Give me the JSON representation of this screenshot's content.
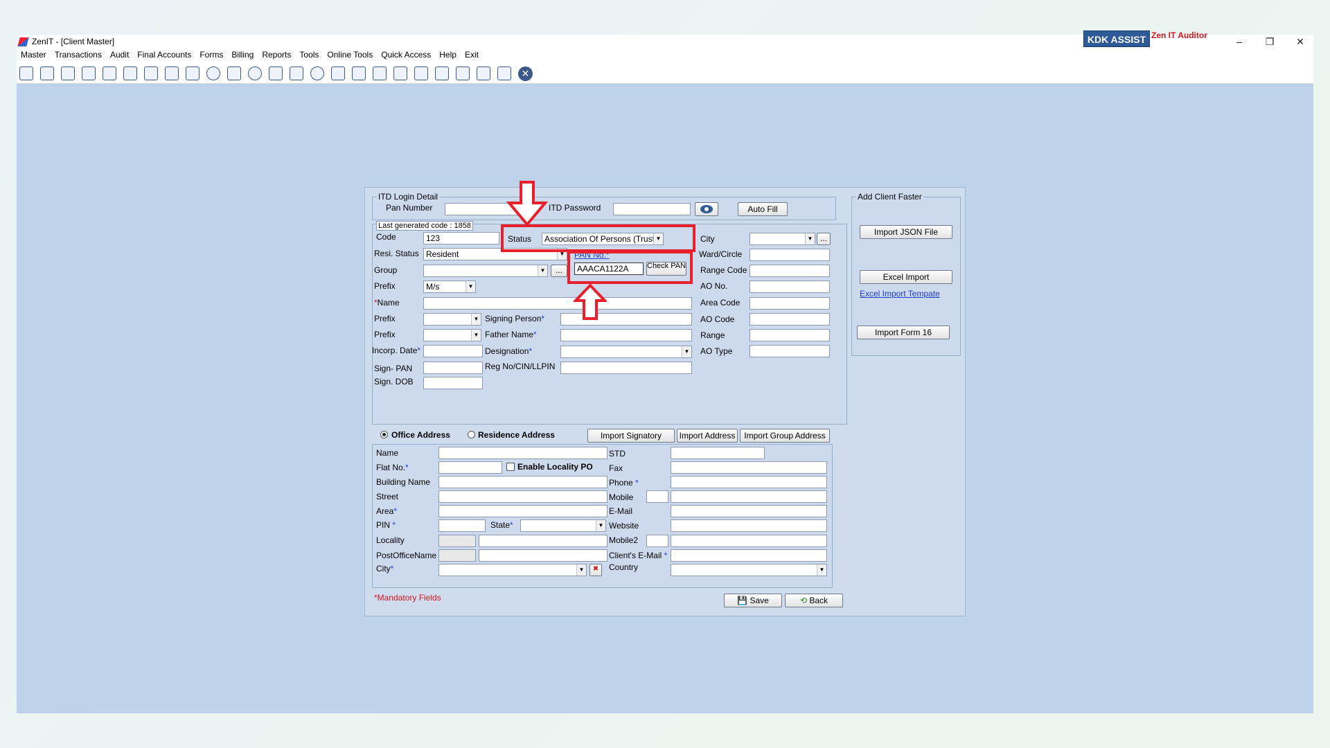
{
  "window": {
    "title": "ZenIT - [Client Master]"
  },
  "menu": [
    "Master",
    "Transactions",
    "Audit",
    "Final Accounts",
    "Forms",
    "Billing",
    "Reports",
    "Tools",
    "Online Tools",
    "Quick Access",
    "Help",
    "Exit"
  ],
  "brand": {
    "kdk": "KDK ASSIST",
    "auditor": "Zen IT Auditor"
  },
  "itd": {
    "legend": "ITD Login Detail",
    "pan_label": "Pan Number",
    "password_label": "ITD Password",
    "autofill": "Auto Fill"
  },
  "client": {
    "last_code": "Last generated code : 1858",
    "code_label": "Code",
    "code_value": "123",
    "status_label": "Status",
    "status_value": "Association Of Persons (Trust)",
    "resi_label": "Resi. Status",
    "resi_value": "Resident",
    "pan_label": "PAN No.",
    "pan_value": "AAACA1122A",
    "check_pan": "Check PAN",
    "group_label": "Group",
    "prefix_label": "Prefix",
    "prefix_value": "M/s",
    "name_label": "Name",
    "prefix2_label": "Prefix",
    "prefix3_label": "Prefix",
    "signing_label": "Signing Person",
    "father_label": "Father Name",
    "incorp_label": "Incorp. Date",
    "designation_label": "Designation",
    "signpan_label": "Sign- PAN",
    "regno_label": "Reg No/CIN/LLPIN",
    "signdob_label": "Sign. DOB",
    "city_label": "City",
    "ward_label": "Ward/Circle",
    "range_code_label": "Range Code",
    "ao_no_label": "AO No.",
    "area_code_label": "Area Code",
    "ao_code_label": "AO Code",
    "range_label": "Range",
    "ao_type_label": "AO Type"
  },
  "address": {
    "office": "Office Address",
    "residence": "Residence Address",
    "import_signatory": "Import Signatory",
    "import_address": "Import Address",
    "import_group": "Import Group Address",
    "name_label": "Name",
    "flat_label": "Flat No.",
    "enable_locality": "Enable Locality PO",
    "building_label": "Building Name",
    "street_label": "Street",
    "area_label": "Area",
    "pin_label": "PIN",
    "state_label": "State",
    "locality_label": "Locality",
    "po_label": "PostOfficeName",
    "city_label": "City",
    "std_label": "STD",
    "fax_label": "Fax",
    "phone_label": "Phone",
    "mobile_label": "Mobile",
    "email_label": "E-Mail",
    "website_label": "Website",
    "mobile2_label": "Mobile2",
    "client_email_label": "Client's E-Mail",
    "country_label": "Country"
  },
  "footer": {
    "mandatory": "*Mandatory Fields",
    "save": "Save",
    "back": "Back"
  },
  "fast": {
    "legend": "Add Client Faster",
    "import_json": "Import JSON File",
    "excel_import": "Excel Import",
    "excel_template": "Excel Import Tempate",
    "import_form16": "Import Form 16"
  },
  "colors": {
    "annotation": "#e8202b",
    "workspace": "#bed2ea"
  }
}
